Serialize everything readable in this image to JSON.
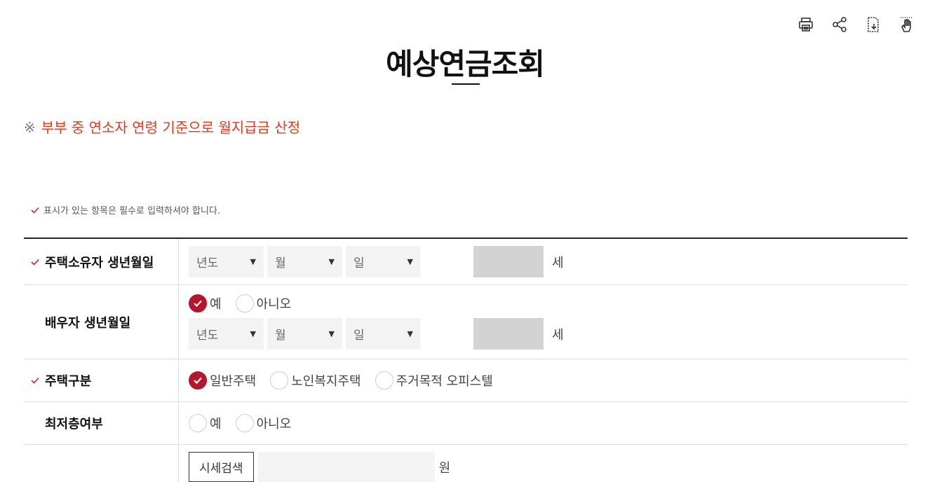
{
  "tools": [
    {
      "icon": "print-icon"
    },
    {
      "icon": "share-icon"
    },
    {
      "icon": "download-icon"
    },
    {
      "icon": "gesture-icon"
    }
  ],
  "title": "예상연금조회",
  "notice": {
    "mark": "※",
    "text": "부부 중 연소자 연령 기준으로 월지급금 산정"
  },
  "required_note": "표시가 있는 항목은 필수로 입력하셔야 합니다.",
  "rows": {
    "owner_birth": {
      "label": "주택소유자 생년월일",
      "year": "년도",
      "month": "월",
      "day": "일",
      "age_unit": "세"
    },
    "spouse_birth": {
      "label": "배우자 생년월일",
      "yes": "예",
      "no": "아니오",
      "year": "년도",
      "month": "월",
      "day": "일",
      "age_unit": "세"
    },
    "house_type": {
      "label": "주택구분",
      "opt1": "일반주택",
      "opt2": "노인복지주택",
      "opt3": "주거목적 오피스텔"
    },
    "lowest_floor": {
      "label": "최저층여부",
      "yes": "예",
      "no": "아니오"
    },
    "price": {
      "search_label": "시세검색",
      "unit": "원"
    }
  },
  "colors": {
    "accent": "#b3172b",
    "notice": "#e03a1e"
  }
}
